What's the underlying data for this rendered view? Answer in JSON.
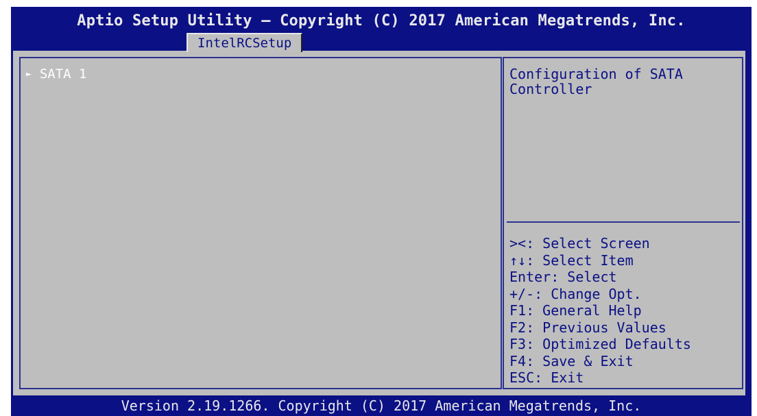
{
  "header": {
    "title": "Aptio Setup Utility – Copyright (C) 2017 American Megatrends, Inc.",
    "active_tab": "IntelRCSetup"
  },
  "menu": {
    "items": [
      {
        "label": "SATA 1",
        "icon": "submenu-arrow-icon"
      }
    ]
  },
  "help": {
    "description": "Configuration of SATA Controller",
    "keys": [
      "><: Select Screen",
      "↑↓: Select Item",
      "Enter: Select",
      "+/-: Change Opt.",
      "F1: General Help",
      "F2: Previous Values",
      "F3: Optimized Defaults",
      "F4: Save & Exit",
      "ESC: Exit"
    ]
  },
  "footer": {
    "text": "Version 2.19.1266. Copyright (C) 2017 American Megatrends, Inc."
  },
  "colors": {
    "background_blue": "#0b1085",
    "panel_gray": "#bebebe",
    "help_text": "#0b1085",
    "menu_text": "#ffffff"
  }
}
